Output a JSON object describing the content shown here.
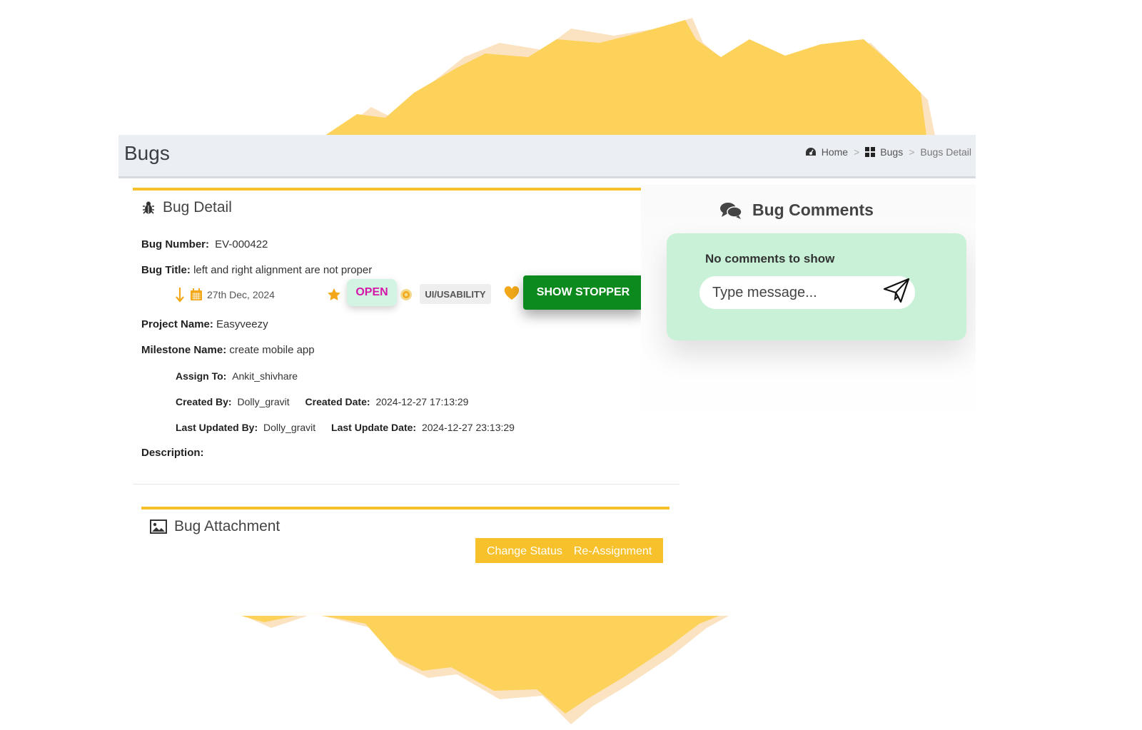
{
  "theme": {
    "accent": "#f7c12b",
    "open_color": "#d417a8",
    "stopper_color": "#0d8a1e",
    "comments_bg": "#c8f1d8"
  },
  "header": {
    "title": "Bugs"
  },
  "breadcrumb": {
    "home": "Home",
    "bugs": "Bugs",
    "current": "Bugs Detail",
    "separator": ">"
  },
  "bug_detail": {
    "heading": "Bug Detail",
    "number_label": "Bug Number:",
    "number": "EV-000422",
    "title_label": "Bug Title:",
    "title": "left and right alignment are not proper",
    "date": "27th Dec, 2024",
    "status": "OPEN",
    "category": "UI/USABILITY",
    "severity": "SHOW STOPPER",
    "project_label": "Project Name:",
    "project": "Easyveezy",
    "milestone_label": "Milestone Name:",
    "milestone": "create mobile app",
    "assign_label": "Assign To:",
    "assign": "Ankit_shivhare",
    "created_by_label": "Created By:",
    "created_by": "Dolly_gravit",
    "created_date_label": "Created Date:",
    "created_date": "2024-12-27 17:13:29",
    "updated_by_label": "Last Updated By:",
    "updated_by": "Dolly_gravit",
    "updated_date_label": "Last Update Date:",
    "updated_date": "2024-12-27 23:13:29",
    "description_label": "Description:"
  },
  "comments": {
    "heading": "Bug Comments",
    "empty": "No comments to show",
    "placeholder": "Type message..."
  },
  "attachment": {
    "heading": "Bug Attachment",
    "change_status": "Change Status",
    "reassign": "Re-Assignment"
  }
}
